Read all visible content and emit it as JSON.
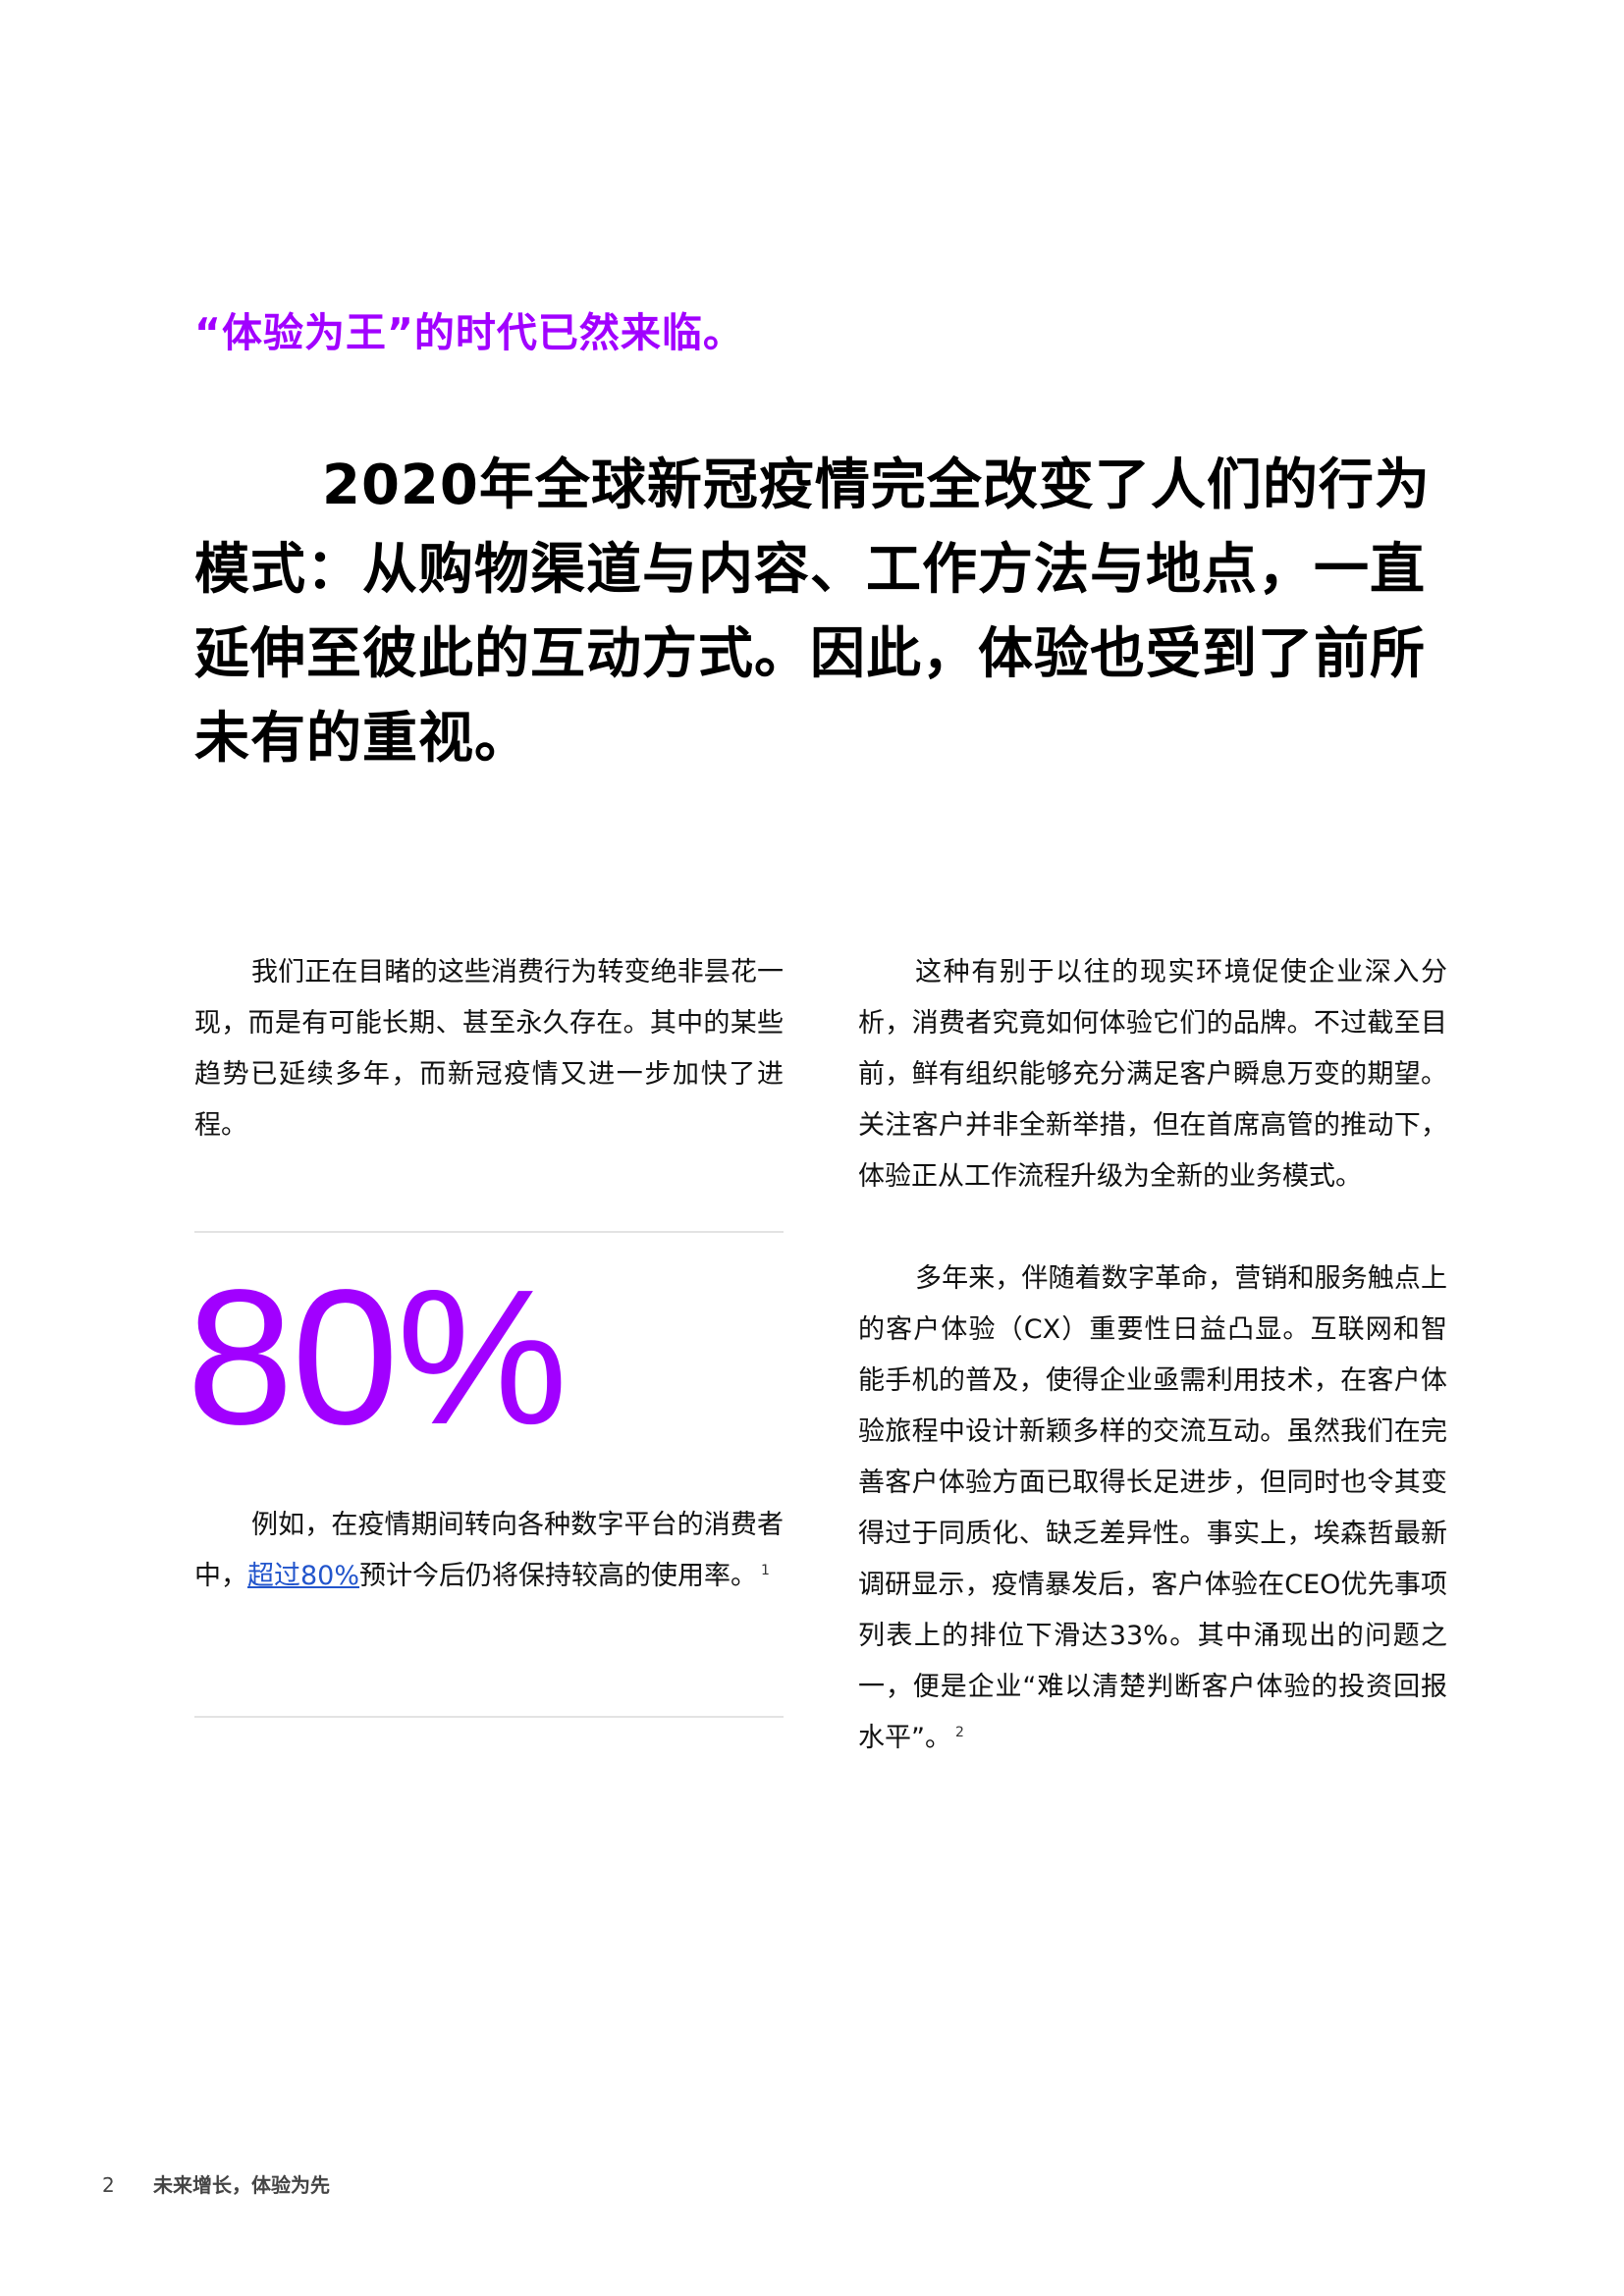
{
  "eyebrow": "“体验为王”的时代已然来临。",
  "headline": "2020年全球新冠疫情完全改变了人们的行为模式：从购物渠道与内容、工作方法与地点，一直延伸至彼此的互动方式。因此，体验也受到了前所未有的重视。",
  "left_column": {
    "paragraph1": "我们正在目睹的这些消费行为转变绝非昙花一现，而是有可能长期、甚至永久存在。其中的某些趋势已延续多年，而新冠疫情又进一步加快了进程。",
    "stat": {
      "number": "80%",
      "text_before": "例如，在疫情期间转向各种数字平台的消费者中，",
      "link_text": "超过80%",
      "text_after": "预计今后仍将保持较高的使用率。",
      "footnote": "1"
    }
  },
  "right_column": {
    "paragraph1": "这种有别于以往的现实环境促使企业深入分析，消费者究竟如何体验它们的品牌。不过截至目前，鲜有组织能够充分满足客户瞬息万变的期望。关注客户并非全新举措，但在首席高管的推动下，体验正从工作流程升级为全新的业务模式。",
    "paragraph2": "多年来，伴随着数字革命，营销和服务触点上的客户体验（CX）重要性日益凸显。互联网和智能手机的普及，使得企业亟需利用技术，在客户体验旅程中设计新颖多样的交流互动。虽然我们在完善客户体验方面已取得长足进步，但同时也令其变得过于同质化、缺乏差异性。事实上，埃森哲最新调研显示，疫情暴发后，客户体验在CEO优先事项列表上的排位下滑达33%。其中涌现出的问题之一，便是企业“难以清楚判断客户体验的投资回报水平”。",
    "footnote2": "2"
  },
  "footer": {
    "page_number": "2",
    "title": "未来增长，体验为先"
  },
  "colors": {
    "accent_purple": "#A100FF",
    "link_blue": "#2255cc",
    "rule_gray": "#e3e3e3"
  }
}
